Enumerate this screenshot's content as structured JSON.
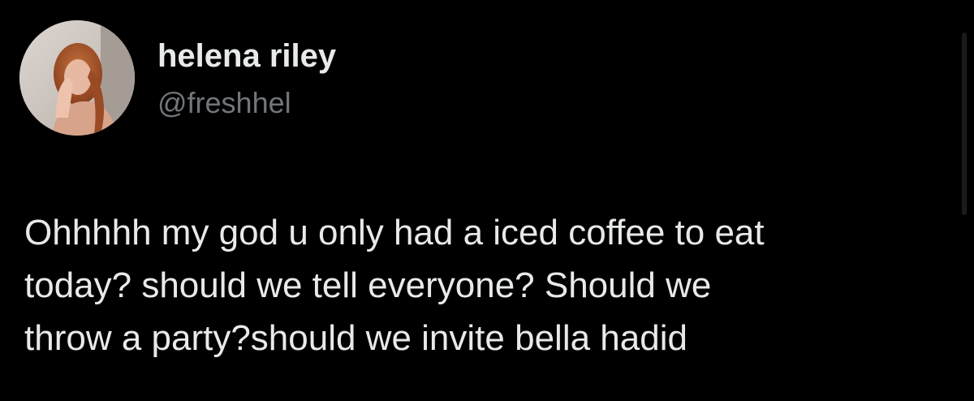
{
  "tweet": {
    "author": {
      "display_name": "helena riley",
      "handle": "@freshhel",
      "avatar_icon": "profile-photo"
    },
    "text_lines": [
      "Ohhhhh my god u only had a iced coffee to eat",
      "today? should we tell everyone? Should we",
      "throw a party?should we invite bella hadid"
    ]
  },
  "colors": {
    "background": "#000000",
    "text": "#e7e9ea",
    "secondary_text": "#71767b"
  }
}
